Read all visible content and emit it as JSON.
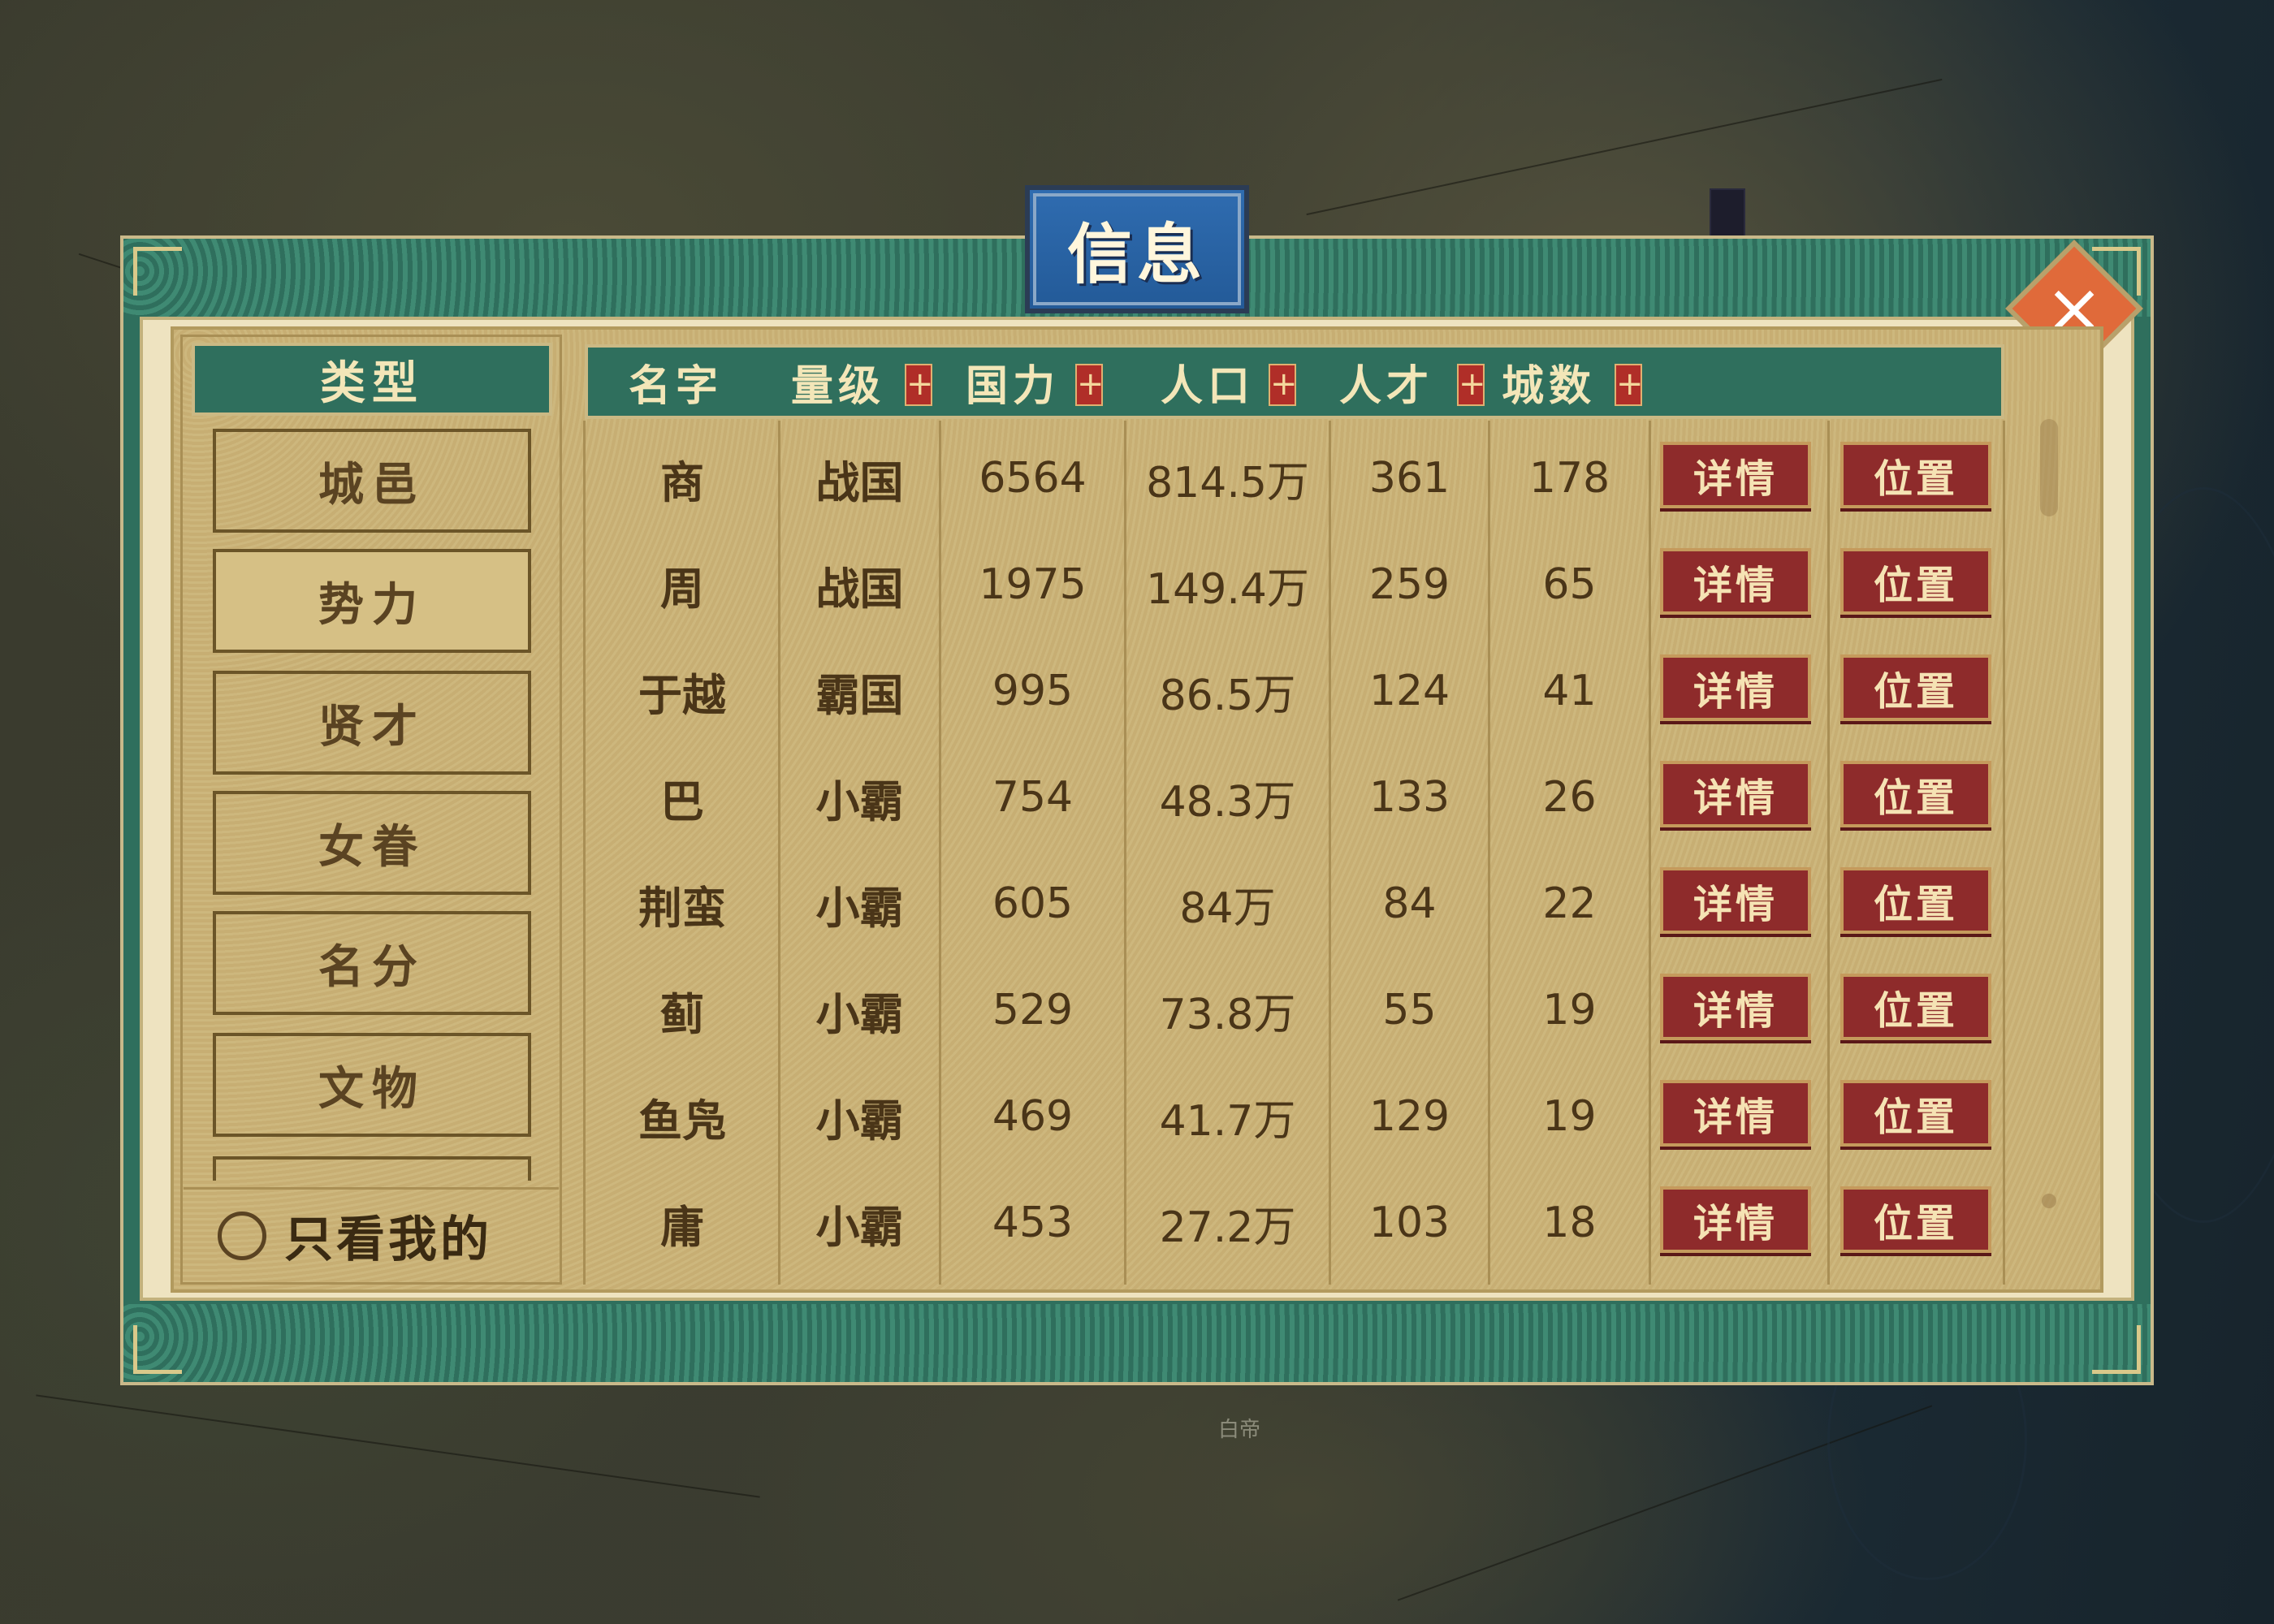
{
  "title": "信息",
  "close_icon": "close-x-icon",
  "map_label": "白帝",
  "sidebar": {
    "header": "类型",
    "tabs": [
      "城邑",
      "势力",
      "贤才",
      "女眷",
      "名分",
      "文物"
    ],
    "active_tab": "势力",
    "filter_label": "只看我的"
  },
  "table": {
    "headers": [
      "名字",
      "量级",
      "国力",
      "人口",
      "人才",
      "城数"
    ],
    "sort_icon": "+",
    "detail_label": "详情",
    "locate_label": "位置",
    "rows": [
      {
        "name": "商",
        "level": "战国",
        "power": "6564",
        "population": "814.5万",
        "talent": "361",
        "cities": "178"
      },
      {
        "name": "周",
        "level": "战国",
        "power": "1975",
        "population": "149.4万",
        "talent": "259",
        "cities": "65"
      },
      {
        "name": "于越",
        "level": "霸国",
        "power": "995",
        "population": "86.5万",
        "talent": "124",
        "cities": "41"
      },
      {
        "name": "巴",
        "level": "小霸",
        "power": "754",
        "population": "48.3万",
        "talent": "133",
        "cities": "26"
      },
      {
        "name": "荆蛮",
        "level": "小霸",
        "power": "605",
        "population": "84万",
        "talent": "84",
        "cities": "22"
      },
      {
        "name": "蓟",
        "level": "小霸",
        "power": "529",
        "population": "73.8万",
        "talent": "55",
        "cities": "19"
      },
      {
        "name": "鱼凫",
        "level": "小霸",
        "power": "469",
        "population": "41.7万",
        "talent": "129",
        "cities": "19"
      },
      {
        "name": "庸",
        "level": "小霸",
        "power": "453",
        "population": "27.2万",
        "talent": "103",
        "cities": "18"
      }
    ]
  },
  "colors": {
    "panel_green": "#2f6f5d",
    "parchment": "#c7ae73",
    "button_red": "#8e2b2b",
    "title_blue": "#2f6cb0",
    "close_orange": "#e06a3a"
  }
}
